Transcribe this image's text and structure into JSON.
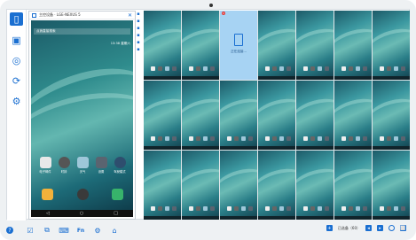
{
  "colors": {
    "accent": "#1a6fd1",
    "selected_tile": "#a7d3f3"
  },
  "left_toolbar": {
    "items": [
      {
        "name": "device-icon",
        "glyph": "▯"
      },
      {
        "name": "screen-icon",
        "glyph": "▣"
      },
      {
        "name": "message-icon",
        "glyph": "◎"
      },
      {
        "name": "sync-icon",
        "glyph": "⟳"
      },
      {
        "name": "settings-icon",
        "glyph": "⚙"
      }
    ]
  },
  "phone": {
    "title": "主控设备 · LGE-NEXUS 5",
    "close": "✕",
    "status_left": "",
    "status_right": "",
    "search_placeholder": "点我直接搜索",
    "time": "13:38 星期六",
    "apps": [
      "电子邮件",
      "时钟",
      "天气",
      "设置",
      "驾驶模式"
    ]
  },
  "grid": {
    "selected_label": "正在连接...",
    "badge": "1"
  },
  "bottom_toolbar": {
    "help": "?",
    "items": [
      "☑",
      "⧉",
      "⌨",
      "Fn",
      "⚙",
      "⌂"
    ],
    "online_label": "已选备（60）",
    "right_icons": [
      "◂",
      "▸",
      "◉",
      "⬜"
    ]
  }
}
